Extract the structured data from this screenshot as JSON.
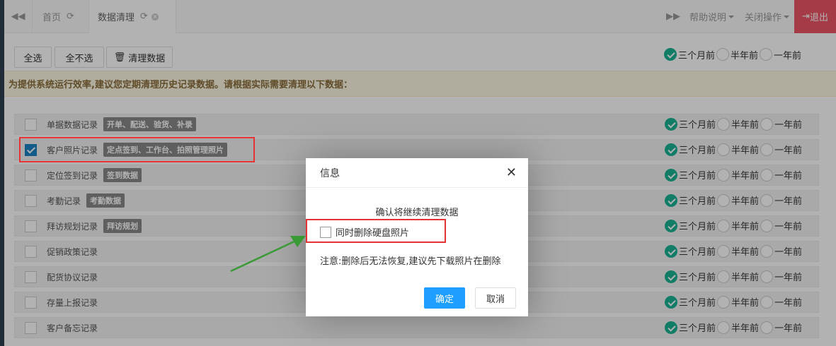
{
  "tabbar": {
    "home_label": "首页",
    "active_tab_label": "数据清理",
    "help_label": "帮助说明",
    "close_ops_label": "关闭操作",
    "logout_label": "退出"
  },
  "toolbar": {
    "select_all": "全选",
    "select_none": "全不选",
    "clean_data": "清理数据",
    "options": [
      "三个月前",
      "半年前",
      "一年前"
    ],
    "selected_option": "三个月前"
  },
  "notice": "为提供系统运行效率,建议您定期清理历史记录数据。请根据实际需要清理以下数据：",
  "rows": [
    {
      "label": "单据数据记录",
      "tag": "开单、配送、验货、补录",
      "checked": false
    },
    {
      "label": "客户照片记录",
      "tag": "定点签到、工作台、拍照管理照片",
      "checked": true
    },
    {
      "label": "定位签到记录",
      "tag": "签到数据",
      "checked": false
    },
    {
      "label": "考勤记录",
      "tag": "考勤数据",
      "checked": false
    },
    {
      "label": "拜访规划记录",
      "tag": "拜访规划",
      "checked": false
    },
    {
      "label": "促销政策记录",
      "tag": "",
      "checked": false
    },
    {
      "label": "配货协议记录",
      "tag": "",
      "checked": false
    },
    {
      "label": "存量上报记录",
      "tag": "",
      "checked": false
    },
    {
      "label": "客户备忘记录",
      "tag": "",
      "checked": false
    }
  ],
  "row_options": [
    "三个月前",
    "半年前",
    "一年前"
  ],
  "dialog": {
    "title": "信息",
    "message": "确认将继续清理数据",
    "option_label": "同时删除硬盘照片",
    "option_checked": false,
    "note": "注意:删除后无法恢复,建议先下载照片在删除",
    "ok_label": "确定",
    "cancel_label": "取消"
  },
  "colors": {
    "accent_green": "#1ab394",
    "checkbox_blue": "#1c84c6",
    "logout_red": "#ed5565",
    "highlight_red": "#e53333",
    "ok_blue": "#1e9fff"
  }
}
